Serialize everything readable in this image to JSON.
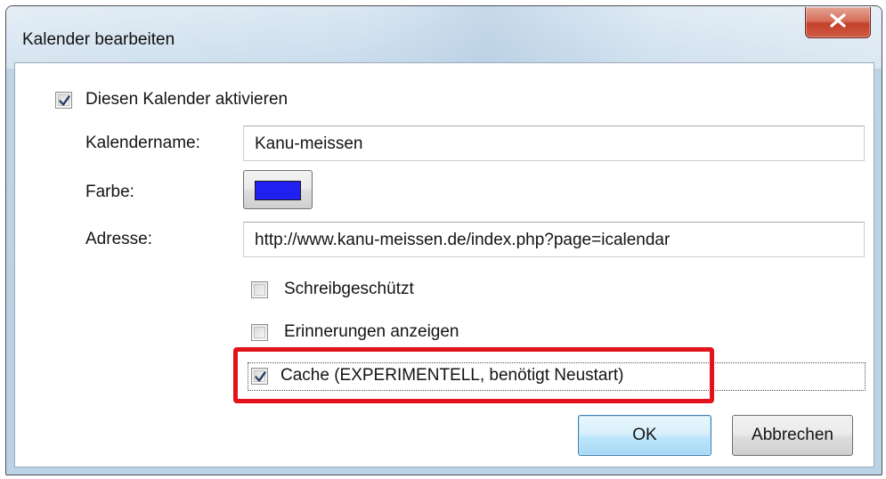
{
  "dialog": {
    "title": "Kalender bearbeiten",
    "close_icon": "close-x-icon"
  },
  "form": {
    "enable_checkbox": {
      "label": "Diesen Kalender aktivieren",
      "checked": true
    },
    "name": {
      "label": "Kalendername:",
      "value": "Kanu-meissen"
    },
    "color": {
      "label": "Farbe:",
      "value": "#2020f0"
    },
    "address": {
      "label": "Adresse:",
      "value": "http://www.kanu-meissen.de/index.php?page=icalendar"
    },
    "readonly_checkbox": {
      "label": "Schreibgeschützt",
      "checked": false
    },
    "reminders_checkbox": {
      "label": "Erinnerungen anzeigen",
      "checked": false
    },
    "cache_checkbox": {
      "label": "Cache (EXPERIMENTELL, benötigt Neustart)",
      "checked": true
    }
  },
  "buttons": {
    "ok": "OK",
    "cancel": "Abbrechen"
  },
  "colors": {
    "highlight": "#e2131b",
    "swatch": "#2020f0"
  }
}
